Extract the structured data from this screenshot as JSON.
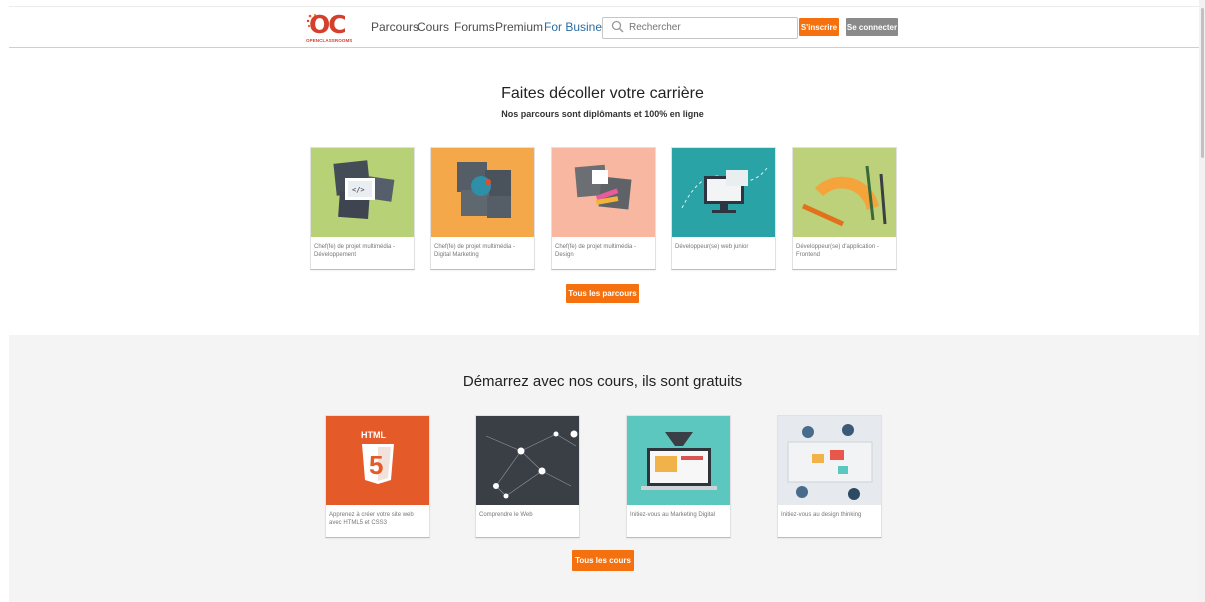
{
  "header": {
    "brand_text": "OPENCLASSROOMS",
    "nav": [
      "Parcours",
      "Cours",
      "Forums",
      "Premium",
      "For Business"
    ],
    "search_placeholder": "Rechercher",
    "signup_label": "S'inscrire",
    "login_label": "Se connecter"
  },
  "parcours": {
    "title": "Faites décoller votre carrière",
    "subtitle": "Nos parcours sont diplômants et 100% en ligne",
    "cards": [
      {
        "label": "Chef(fe) de projet multimédia - Développement",
        "color": "#b7d177"
      },
      {
        "label": "Chef(fe) de projet multimédia - Digital Marketing",
        "color": "#f5a84a"
      },
      {
        "label": "Chef(fe) de projet multimédia - Design",
        "color": "#f7b7a0"
      },
      {
        "label": "Développeur(se) web junior",
        "color": "#2aa3a7"
      },
      {
        "label": "Développeur(se) d'application - Frontend",
        "color": "#bdd07a"
      }
    ],
    "all_label": "Tous les parcours"
  },
  "cours": {
    "title": "Démarrez avec nos cours, ils sont gratuits",
    "cards": [
      {
        "label": "Apprenez à créer votre site web avec HTML5 et CSS3",
        "color": "#e45a29"
      },
      {
        "label": "Comprendre le Web",
        "color": "#3a3f46"
      },
      {
        "label": "Initiez-vous au Marketing Digital",
        "color": "#5bc7bf"
      },
      {
        "label": "Initiez-vous au design thinking",
        "color": "#e6e9ee"
      }
    ],
    "all_label": "Tous les cours"
  },
  "colors": {
    "accent": "#f5710f",
    "secondary_button": "#8a8a8a"
  }
}
